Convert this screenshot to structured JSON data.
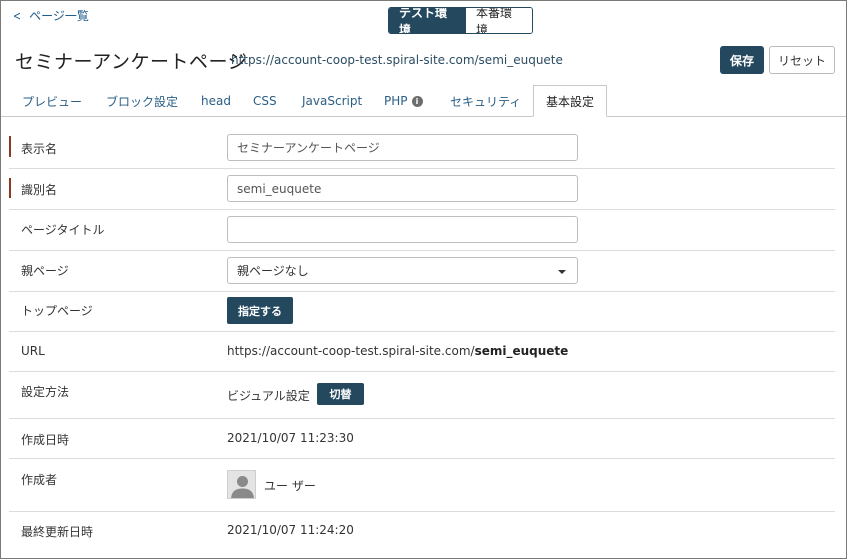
{
  "nav": {
    "back_label": "ページ一覧"
  },
  "env": {
    "test_label": "テスト環境",
    "prod_label": "本番環境"
  },
  "header": {
    "title": "セミナーアンケートページ",
    "url": "https://account-coop-test.spiral-site.com/semi_euquete",
    "save_label": "保存",
    "reset_label": "リセット"
  },
  "tabs": [
    {
      "label": "プレビュー"
    },
    {
      "label": "ブロック設定"
    },
    {
      "label": "head"
    },
    {
      "label": "CSS"
    },
    {
      "label": "JavaScript"
    },
    {
      "label": "PHP"
    },
    {
      "label": "セキュリティ"
    },
    {
      "label": "基本設定"
    }
  ],
  "form": {
    "display_name": {
      "label": "表示名",
      "value": "セミナーアンケートページ"
    },
    "identifier": {
      "label": "識別名",
      "value": "semi_euquete"
    },
    "page_title": {
      "label": "ページタイトル",
      "value": ""
    },
    "parent_page": {
      "label": "親ページ",
      "value": "親ページなし"
    },
    "top_page": {
      "label": "トップページ",
      "button_label": "指定する"
    },
    "url": {
      "label": "URL",
      "base": "https://account-coop-test.spiral-site.com/",
      "slug": "semi_euquete"
    },
    "setting_method": {
      "label": "設定方法",
      "value": "ビジュアル設定",
      "button_label": "切替"
    },
    "created_at": {
      "label": "作成日時",
      "value": "2021/10/07 11:23:30"
    },
    "creator": {
      "label": "作成者",
      "name": "ユー ザー"
    },
    "updated_at": {
      "label": "最終更新日時",
      "value": "2021/10/07 11:24:20"
    }
  },
  "colors": {
    "primary": "#24495f",
    "link": "#1f5b8a",
    "required_marker": "#8a3a1f"
  }
}
